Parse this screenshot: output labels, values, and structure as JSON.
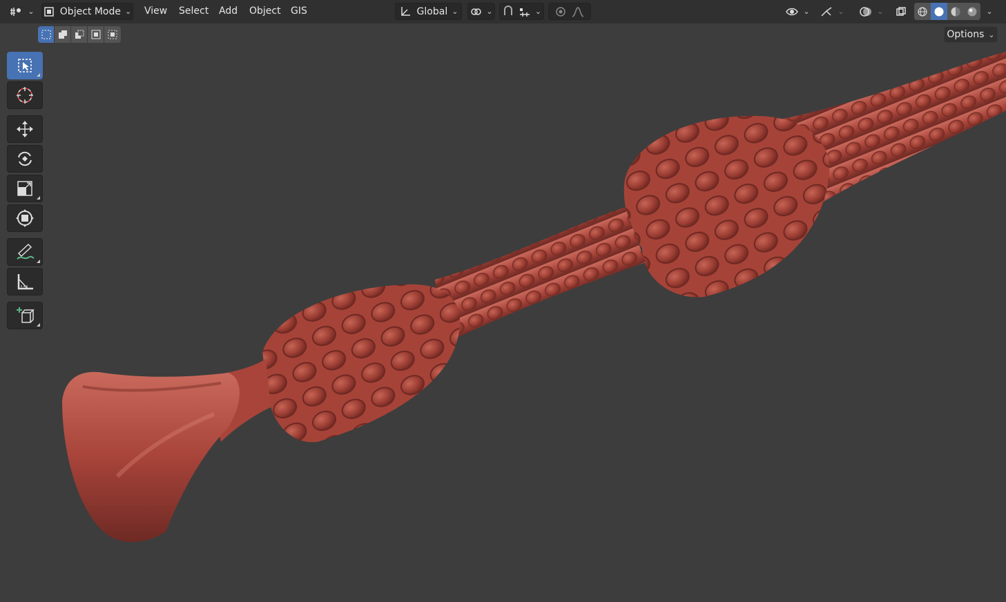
{
  "header": {
    "editor_type_icon": "3d-viewport-icon",
    "mode_label": "Object Mode",
    "menus": [
      "View",
      "Select",
      "Add",
      "Object",
      "GIS"
    ],
    "orientation_label": "Global",
    "options_label": "Options"
  },
  "toolbar": {
    "tools": [
      "select-box-icon",
      "cursor-icon",
      "move-icon",
      "rotate-icon",
      "scale-icon",
      "transform-icon",
      "annotate-icon",
      "measure-icon",
      "add-cube-icon"
    ]
  },
  "colors": {
    "header_bg": "#303030",
    "viewport_bg": "#3d3d3d",
    "accent": "#4772b3",
    "mesh": "#b04a40"
  }
}
